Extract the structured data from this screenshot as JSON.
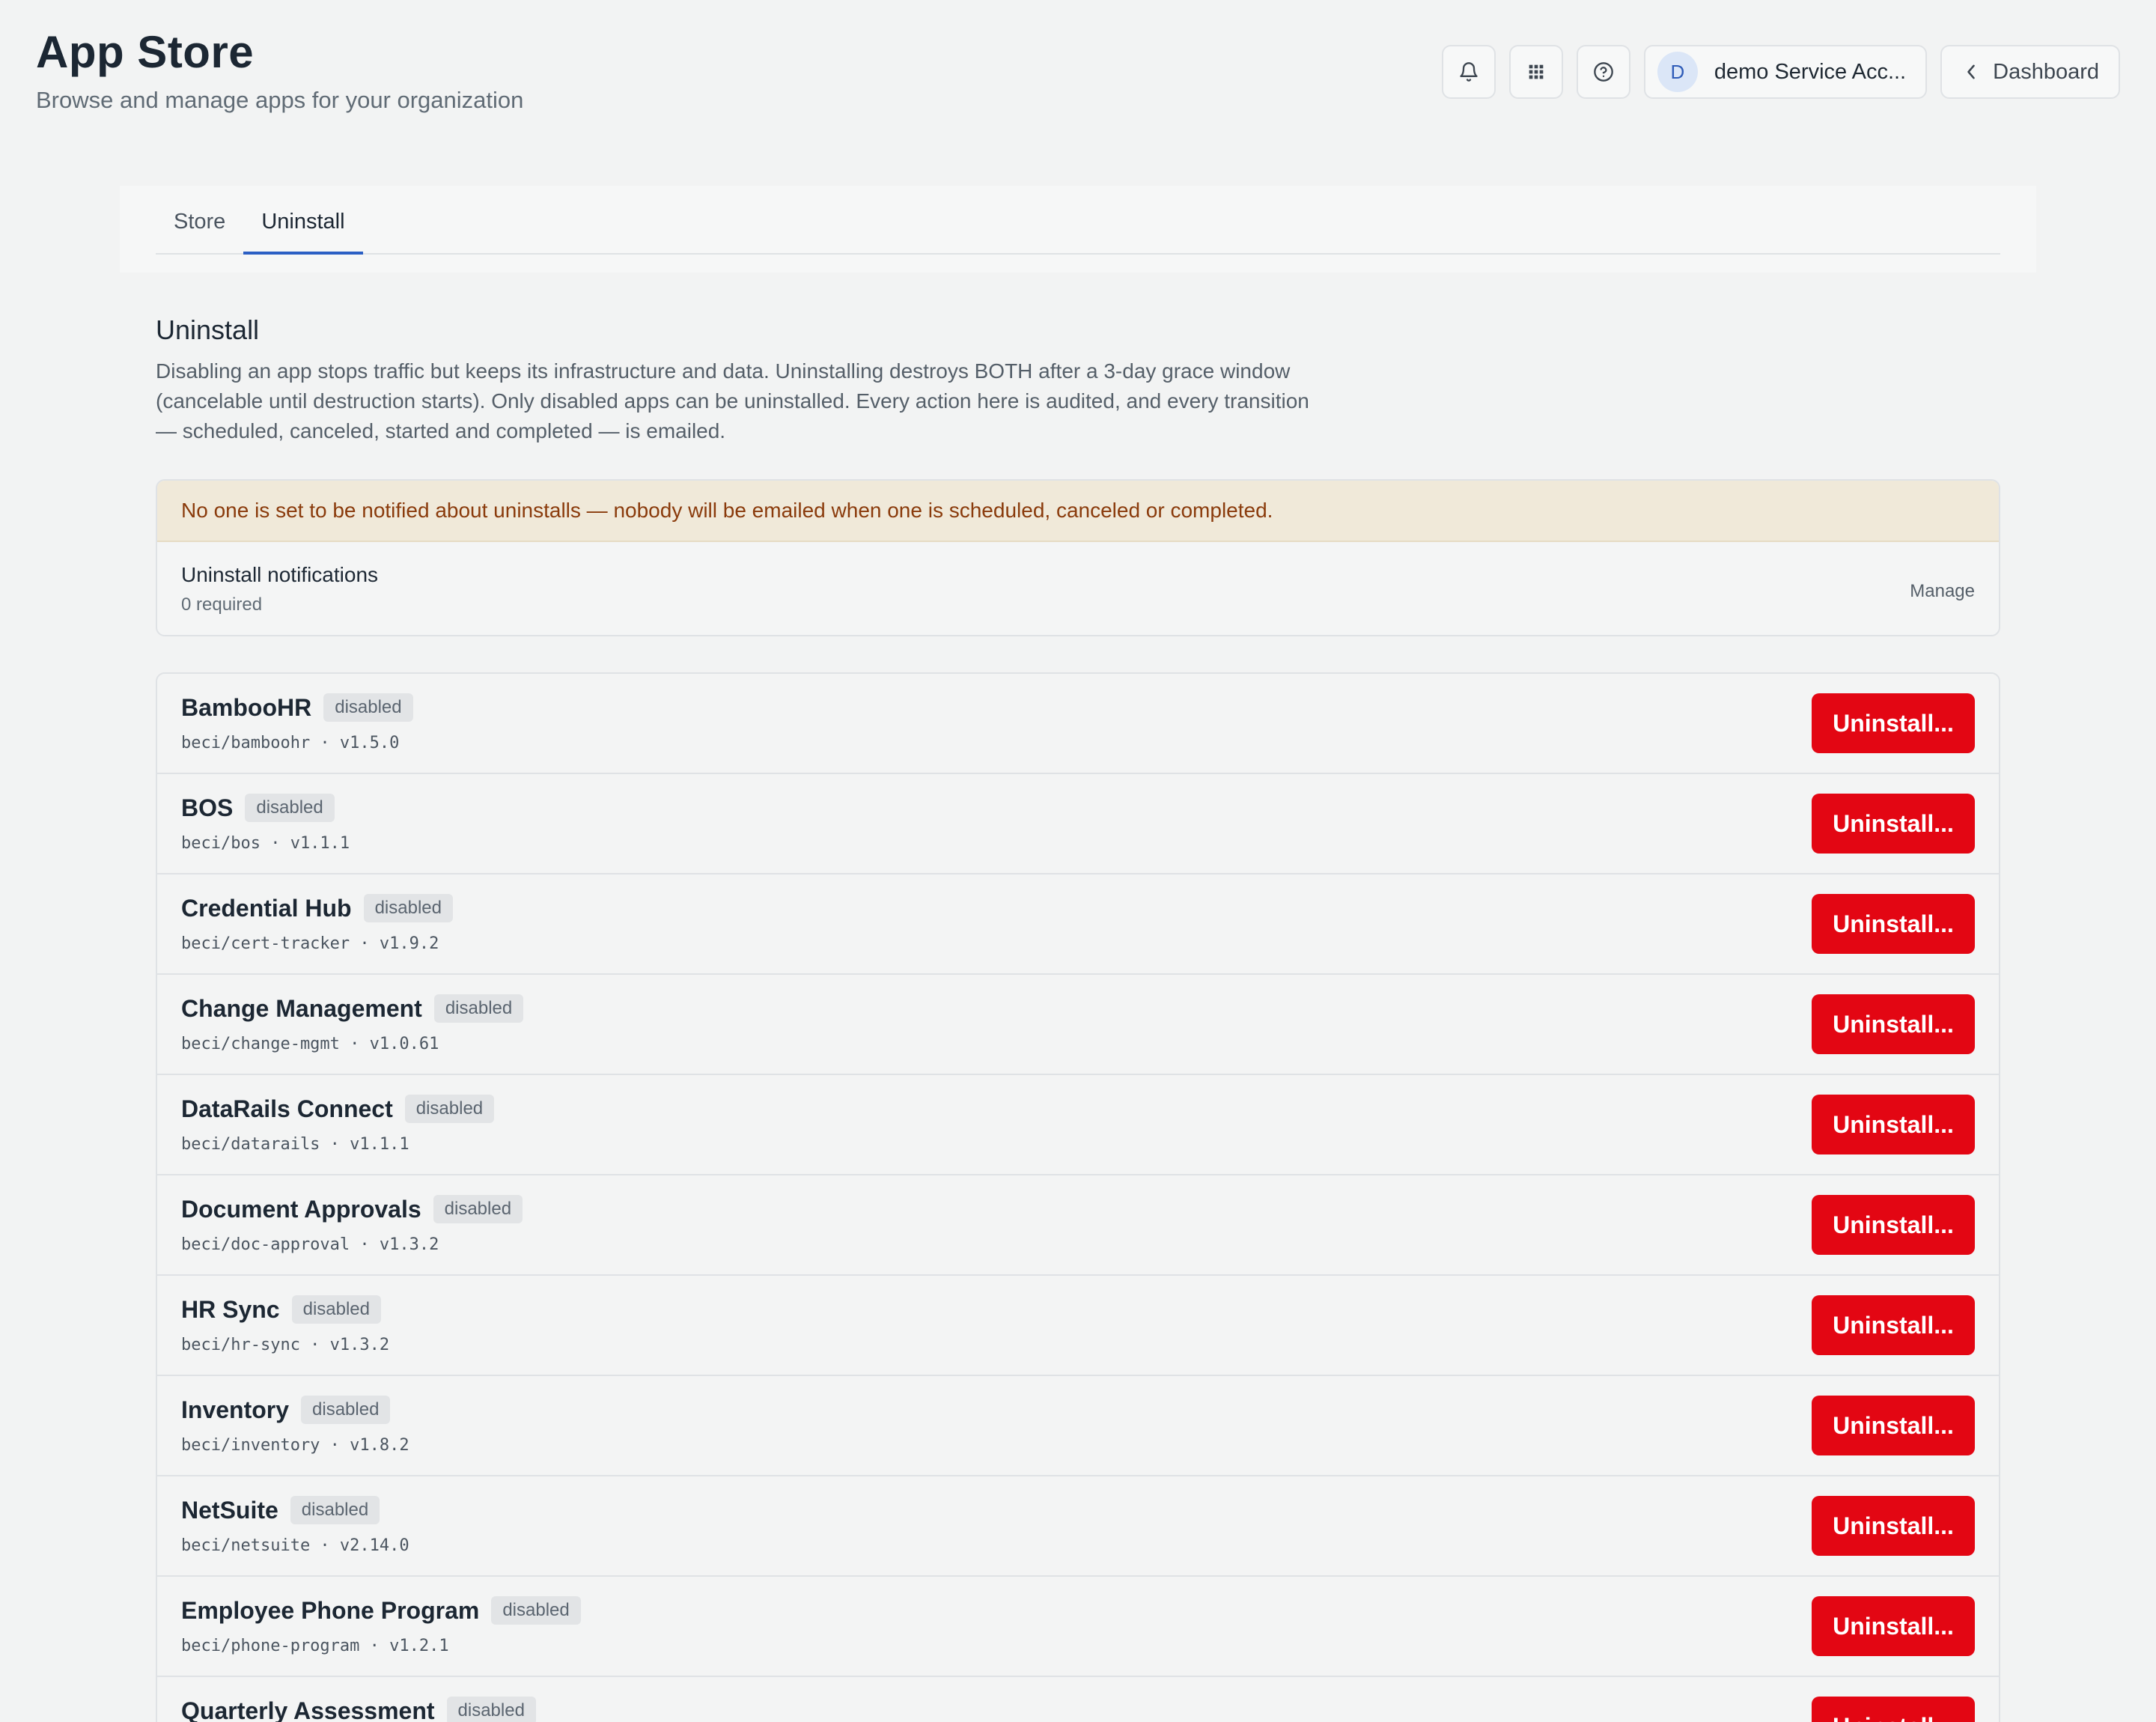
{
  "header": {
    "title": "App Store",
    "subtitle": "Browse and manage apps for your organization",
    "notifications_icon": "bell-icon",
    "apps_icon": "grid-icon",
    "help_icon": "help-circle-icon",
    "account": {
      "avatar_initial": "D",
      "name": "demo Service Acc..."
    },
    "dashboard_label": "Dashboard"
  },
  "tabs": [
    {
      "label": "Store",
      "active": false
    },
    {
      "label": "Uninstall",
      "active": true
    }
  ],
  "section": {
    "title": "Uninstall",
    "description": "Disabling an app stops traffic but keeps its infrastructure and data. Uninstalling destroys BOTH after a 3-day grace window (cancelable until destruction starts). Only disabled apps can be uninstalled. Every action here is audited, and every transition — scheduled, canceled, started and completed — is emailed."
  },
  "notifications": {
    "warning": "No one is set to be notified about uninstalls — nobody will be emailed when one is scheduled, canceled or completed.",
    "title": "Uninstall notifications",
    "subtitle": "0 required",
    "manage_label": "Manage"
  },
  "apps": [
    {
      "name": "BambooHR",
      "status": "disabled",
      "meta": "beci/bamboohr · v1.5.0",
      "action": "Uninstall..."
    },
    {
      "name": "BOS",
      "status": "disabled",
      "meta": "beci/bos · v1.1.1",
      "action": "Uninstall..."
    },
    {
      "name": "Credential Hub",
      "status": "disabled",
      "meta": "beci/cert-tracker · v1.9.2",
      "action": "Uninstall..."
    },
    {
      "name": "Change Management",
      "status": "disabled",
      "meta": "beci/change-mgmt · v1.0.61",
      "action": "Uninstall..."
    },
    {
      "name": "DataRails Connect",
      "status": "disabled",
      "meta": "beci/datarails · v1.1.1",
      "action": "Uninstall..."
    },
    {
      "name": "Document Approvals",
      "status": "disabled",
      "meta": "beci/doc-approval · v1.3.2",
      "action": "Uninstall..."
    },
    {
      "name": "HR Sync",
      "status": "disabled",
      "meta": "beci/hr-sync · v1.3.2",
      "action": "Uninstall..."
    },
    {
      "name": "Inventory",
      "status": "disabled",
      "meta": "beci/inventory · v1.8.2",
      "action": "Uninstall..."
    },
    {
      "name": "NetSuite",
      "status": "disabled",
      "meta": "beci/netsuite · v2.14.0",
      "action": "Uninstall..."
    },
    {
      "name": "Employee Phone Program",
      "status": "disabled",
      "meta": "beci/phone-program · v1.2.1",
      "action": "Uninstall..."
    },
    {
      "name": "Quarterly Assessment",
      "status": "disabled",
      "meta": "",
      "action": "Uninstall..."
    }
  ],
  "colors": {
    "accent": "#2b5fc4",
    "danger": "#e30613",
    "warning_bg": "#f0e9d9",
    "warning_text": "#8a3b0c"
  }
}
